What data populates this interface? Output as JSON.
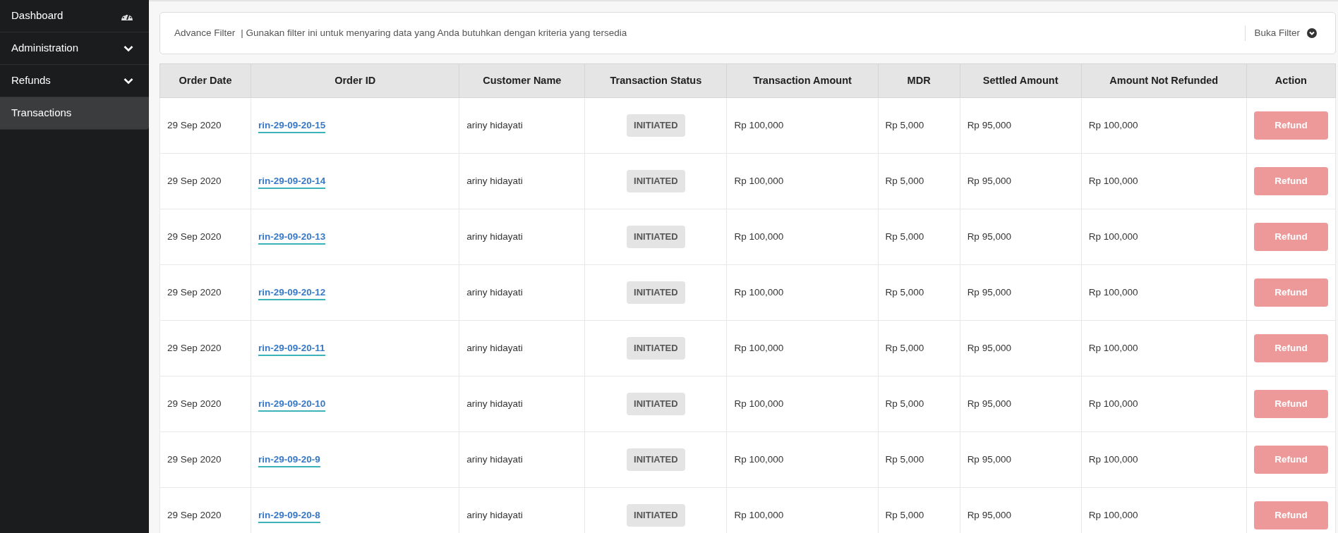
{
  "sidebar": {
    "items": [
      {
        "label": "Dashboard",
        "kind": "link",
        "selected": false
      },
      {
        "label": "Administration",
        "kind": "group",
        "selected": false
      },
      {
        "label": "Refunds",
        "kind": "group",
        "selected": false
      },
      {
        "label": "Transactions",
        "kind": "plain",
        "selected": true
      }
    ]
  },
  "filter": {
    "title": "Advance Filter",
    "description": "| Gunakan filter ini untuk menyaring data yang Anda butuhkan dengan kriteria yang tersedia",
    "toggle": "Buka Filter"
  },
  "table": {
    "columns": [
      "Order Date",
      "Order ID",
      "Customer Name",
      "Transaction Status",
      "Transaction Amount",
      "MDR",
      "Settled Amount",
      "Amount Not Refunded",
      "Action"
    ],
    "rows": [
      {
        "order_date": "29 Sep 2020",
        "order_id": "rin-29-09-20-15",
        "customer": "ariny hidayati",
        "status": "INITIATED",
        "amount": "Rp 100,000",
        "mdr": "Rp 5,000",
        "settled": "Rp 95,000",
        "not_refunded": "Rp 100,000",
        "action": "Refund",
        "disabled": true
      },
      {
        "order_date": "29 Sep 2020",
        "order_id": "rin-29-09-20-14",
        "customer": "ariny hidayati",
        "status": "INITIATED",
        "amount": "Rp 100,000",
        "mdr": "Rp 5,000",
        "settled": "Rp 95,000",
        "not_refunded": "Rp 100,000",
        "action": "Refund",
        "disabled": true
      },
      {
        "order_date": "29 Sep 2020",
        "order_id": "rin-29-09-20-13",
        "customer": "ariny hidayati",
        "status": "INITIATED",
        "amount": "Rp 100,000",
        "mdr": "Rp 5,000",
        "settled": "Rp 95,000",
        "not_refunded": "Rp 100,000",
        "action": "Refund",
        "disabled": true
      },
      {
        "order_date": "29 Sep 2020",
        "order_id": "rin-29-09-20-12",
        "customer": "ariny hidayati",
        "status": "INITIATED",
        "amount": "Rp 100,000",
        "mdr": "Rp 5,000",
        "settled": "Rp 95,000",
        "not_refunded": "Rp 100,000",
        "action": "Refund",
        "disabled": true
      },
      {
        "order_date": "29 Sep 2020",
        "order_id": "rin-29-09-20-11",
        "customer": "ariny hidayati",
        "status": "INITIATED",
        "amount": "Rp 100,000",
        "mdr": "Rp 5,000",
        "settled": "Rp 95,000",
        "not_refunded": "Rp 100,000",
        "action": "Refund",
        "disabled": true
      },
      {
        "order_date": "29 Sep 2020",
        "order_id": "rin-29-09-20-10",
        "customer": "ariny hidayati",
        "status": "INITIATED",
        "amount": "Rp 100,000",
        "mdr": "Rp 5,000",
        "settled": "Rp 95,000",
        "not_refunded": "Rp 100,000",
        "action": "Refund",
        "disabled": true
      },
      {
        "order_date": "29 Sep 2020",
        "order_id": "rin-29-09-20-9",
        "customer": "ariny hidayati",
        "status": "INITIATED",
        "amount": "Rp 100,000",
        "mdr": "Rp 5,000",
        "settled": "Rp 95,000",
        "not_refunded": "Rp 100,000",
        "action": "Refund",
        "disabled": true
      },
      {
        "order_date": "29 Sep 2020",
        "order_id": "rin-29-09-20-8",
        "customer": "ariny hidayati",
        "status": "INITIATED",
        "amount": "Rp 100,000",
        "mdr": "Rp 5,000",
        "settled": "Rp 95,000",
        "not_refunded": "Rp 100,000",
        "action": "Refund",
        "disabled": true
      }
    ]
  }
}
